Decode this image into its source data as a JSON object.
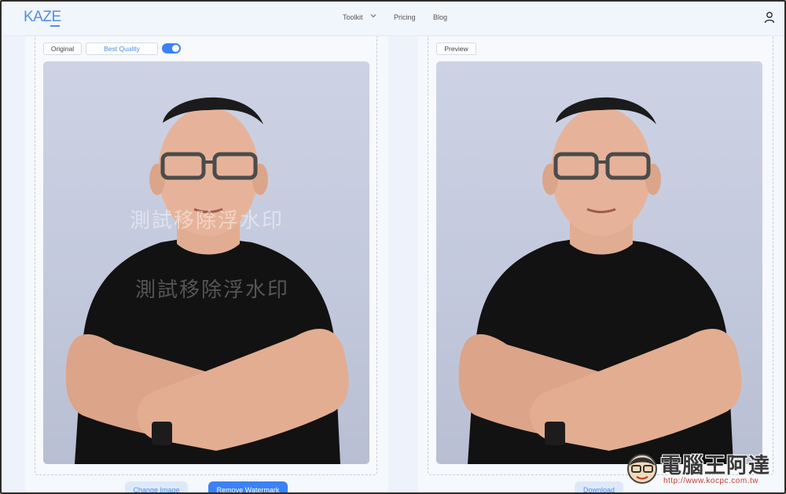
{
  "header": {
    "logo": "KAZE",
    "nav": {
      "toolkit": "Toolkit",
      "pricing": "Pricing",
      "blog": "Blog"
    }
  },
  "left_panel": {
    "original_label": "Original",
    "quality_label": "Best Quality",
    "quality_toggle_on": true,
    "watermark_lines": [
      "測試移除浮水印",
      "測試移除浮水印"
    ],
    "buttons": {
      "change_image": "Change Image",
      "remove_watermark": "Remove Watermark"
    }
  },
  "right_panel": {
    "preview_label": "Preview",
    "buttons": {
      "download": "Download"
    }
  },
  "site_watermark": {
    "name": "電腦王阿達",
    "url": "http://www.kocpc.com.tw"
  },
  "colors": {
    "accent": "#3b82f6",
    "accent_light": "#dde9fb",
    "logo": "#4f8ee8"
  },
  "icons": [
    "chevron-down-icon",
    "user-icon",
    "toggle-switch"
  ]
}
